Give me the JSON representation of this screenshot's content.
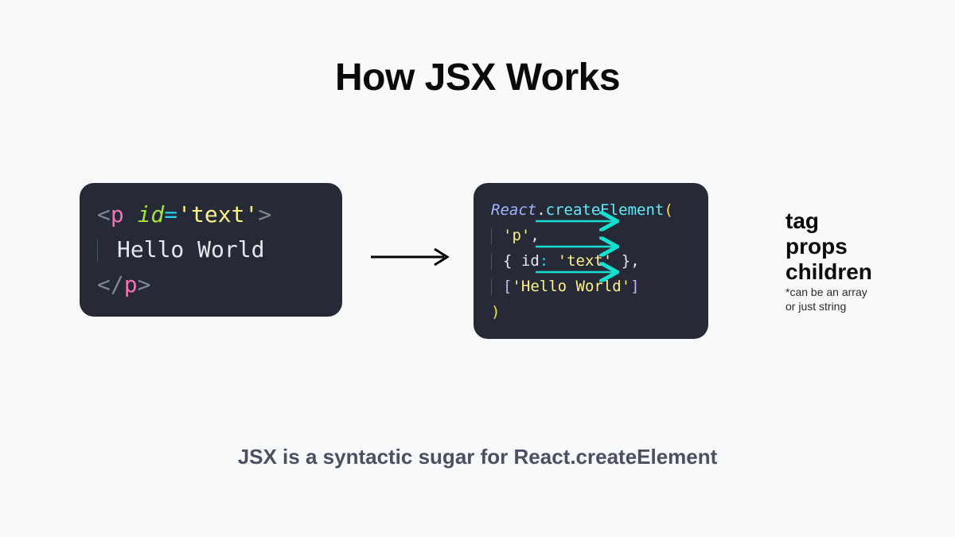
{
  "title": "How JSX Works",
  "caption": "JSX is a syntactic sugar for React.createElement",
  "jsx": {
    "open_angle": "<",
    "tag": "p",
    "space": " ",
    "attr_name": "id",
    "op_eq": "=",
    "attr_value": "'text'",
    "close_angle": ">",
    "content": "Hello World",
    "close_open": "</",
    "close_tag": "p",
    "close_close": ">"
  },
  "react": {
    "obj": "React",
    "dot": ".",
    "method": "createElement",
    "paren_open": "(",
    "arg_tag": "'p'",
    "comma": ",",
    "brace_open": "{ ",
    "key": "id",
    "colon": ": ",
    "val": "'text'",
    "brace_close": " }",
    "brk_open": "[",
    "child": "'Hello World'",
    "brk_close": "]",
    "paren_close": ")"
  },
  "annotations": {
    "tag": "tag",
    "props": "props",
    "children": "children",
    "note": "*can be an array\nor just string"
  },
  "colors": {
    "arrow_main": "#000000",
    "arrow_anno": "#14e0d1"
  }
}
